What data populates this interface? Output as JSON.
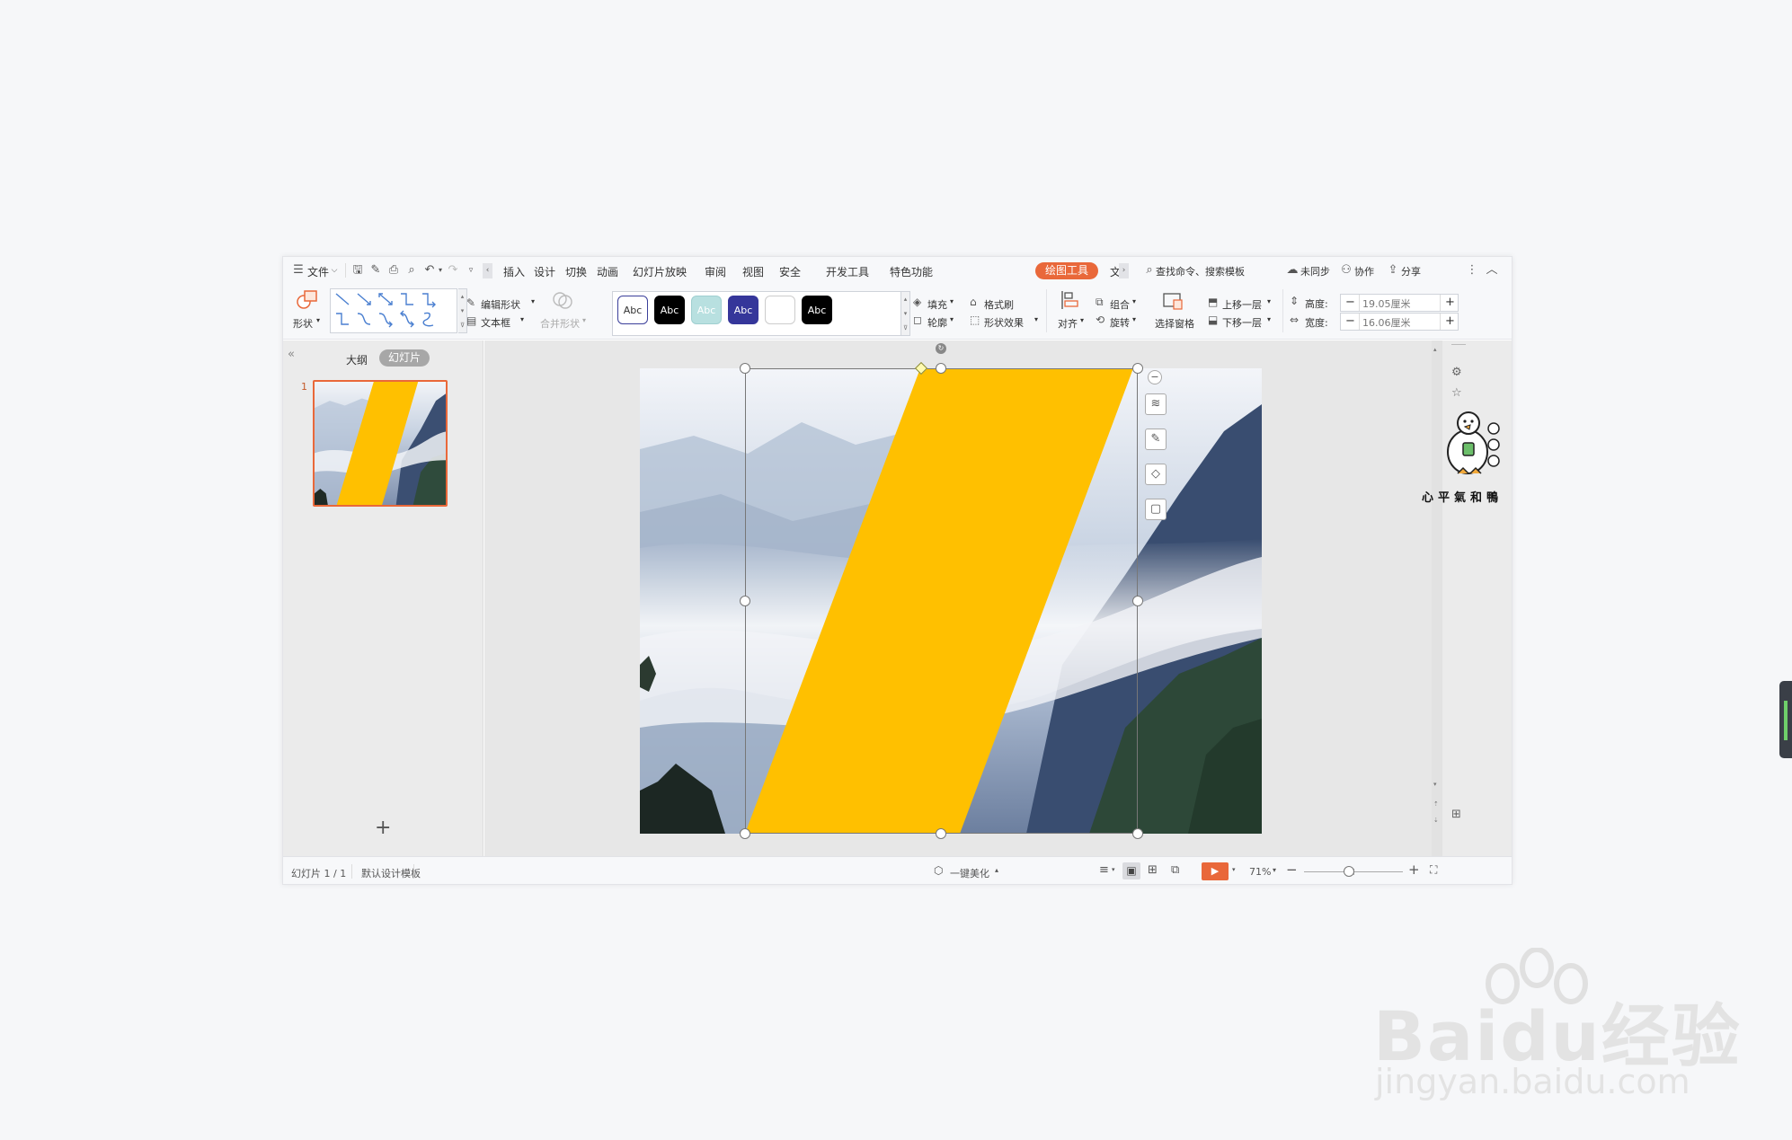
{
  "menubar": {
    "file": "文件",
    "tabs": [
      "插入",
      "设计",
      "切换",
      "动画",
      "幻灯片放映",
      "审阅",
      "视图",
      "安全",
      "开发工具",
      "特色功能"
    ],
    "active_tab": "绘图工具",
    "overflow_tab": "文",
    "search": "查找命令、搜索模板",
    "sync": "未同步",
    "collab": "协作",
    "share": "分享"
  },
  "ribbon": {
    "shape": "形状",
    "edit_shape": "编辑形状",
    "text_box": "文本框",
    "merge_shape": "合并形状",
    "styles": [
      {
        "label": "Abc",
        "bg": "#ffffff",
        "fg": "#333333",
        "border": "#3b3f9a"
      },
      {
        "label": "Abc",
        "bg": "#000000",
        "fg": "#ffffff",
        "border": "#000000"
      },
      {
        "label": "Abc",
        "bg": "#b8e0e0",
        "fg": "#ffffff",
        "border": "#9fcfd0"
      },
      {
        "label": "Abc",
        "bg": "#35369a",
        "fg": "#ffffff",
        "border": "#35369a"
      },
      {
        "label": "",
        "bg": "#ffffff",
        "fg": "#333333",
        "border": "#cccccc"
      },
      {
        "label": "Abc",
        "bg": "#000000",
        "fg": "#ffffff",
        "border": "#000000"
      }
    ],
    "fill": "填充",
    "outline": "轮廓",
    "format_painter": "格式刷",
    "shape_effects": "形状效果",
    "align": "对齐",
    "group": "组合",
    "rotate": "旋转",
    "selection_pane": "选择窗格",
    "bring_forward": "上移一层",
    "send_backward": "下移一层",
    "height_label": "高度:",
    "height_value": "19.05厘米",
    "width_label": "宽度:",
    "width_value": "16.06厘米"
  },
  "leftpanel": {
    "outline_tab": "大纲",
    "slides_tab": "幻灯片",
    "slide_number": "1"
  },
  "statusbar": {
    "slide_info": "幻灯片 1 / 1",
    "template": "默认设计模板",
    "beautify": "一键美化",
    "zoom": "71%",
    "zoom_fraction": 0.45
  },
  "colors": {
    "accent": "#e9683a",
    "shape_fill": "#ffc000"
  },
  "watermark": {
    "duck_caption": "心平氣和鴨",
    "logo": "Baidu经验",
    "url": "jingyan.baidu.com"
  }
}
